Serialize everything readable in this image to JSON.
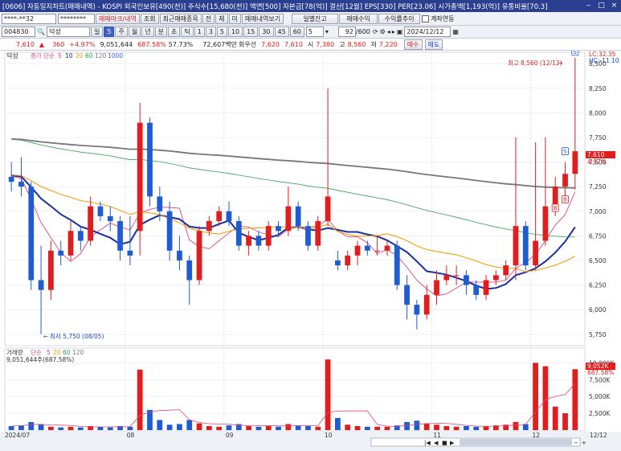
{
  "title": "[0606] 자동일지차트(매매내역) - KOSPI 외국인보유[490(천)] 주식수[15,680(천)] 액면[500] 자본금[78(억)] 결산[12월] EPS[330] PER[23.06] 시가총액[1,193(억)] 유통비율[70.3]",
  "toolbar1": {
    "account": "****-**32",
    "password": "********",
    "buttons": [
      "매매마크/내역",
      "조회",
      "최근매매종목",
      "전",
      "체",
      "미",
      "매매내역보기"
    ],
    "right_buttons": [
      "일별잔고",
      "매매수익",
      "수익률추이"
    ],
    "checkbox_label": "계좌연동"
  },
  "toolbar2": {
    "code": "004830",
    "name": "덕성",
    "periods": [
      "일",
      "5",
      "주",
      "월",
      "년",
      "분",
      "초",
      "틱"
    ],
    "intervals": [
      "1",
      "3",
      "5",
      "10",
      "15",
      "30",
      "45",
      "60"
    ],
    "interval_select": "5",
    "count": "92",
    "total": "600",
    "date": "2024/12/12"
  },
  "quote": {
    "price": "7,610",
    "change": "360",
    "change_pct": "+4.97%",
    "volume": "9,051,644",
    "volume_ratio": "687.58%",
    "turnover": "57.73%",
    "amount": "72,607백만",
    "prefname_label": "회우선",
    "pref_price": "7,620",
    "close_label": "7,610",
    "open_label": "시",
    "open": "7,380",
    "high_label": "고",
    "high": "8,560",
    "low_label": "저",
    "low": "7,220",
    "buy_label": "매수",
    "sell_label": "매도"
  },
  "chart": {
    "stock_name": "덕성",
    "ma_label": "종가 단순",
    "ma_periods": [
      "5",
      "10",
      "20",
      "60",
      "120",
      "1000"
    ],
    "ma_colors": [
      "#e0457b",
      "#1a2ea0",
      "#f0a010",
      "#30a050",
      "#777777",
      "#4060e0"
    ],
    "up_color": "#e11d1d",
    "down_color": "#1f5bd1",
    "high_annotation": "최고 8,560 (12/12)",
    "low_annotation": "최저 5,750 (08/05)",
    "lc_label": "LC:32.35",
    "hc_label": "HC:-11.10",
    "price_tag": "7,610",
    "price_tag_pct": "4.97%",
    "y_ticks": [
      "8,500",
      "8,250",
      "8,000",
      "7,750",
      "7,500",
      "7,250",
      "7,000",
      "6,750",
      "6,500",
      "6,250",
      "6,000",
      "5,750"
    ],
    "x_labels": [
      "2024/07",
      "08",
      "09",
      "10",
      "11",
      "12",
      "12/12"
    ],
    "markers": [
      "S",
      "S",
      "B",
      "B"
    ]
  },
  "volume": {
    "label": "거래량",
    "ma_label": "단순",
    "ma_periods": [
      "5",
      "20",
      "60",
      "120"
    ],
    "summary": "9,051,644주(687.58%)",
    "y_ticks": [
      "10,000K",
      "7,500K",
      "5,000K",
      "2,500K"
    ],
    "vol_tag": "9,052K",
    "vol_tag_pct": "687.58%"
  },
  "chart_data": {
    "type": "candlestick",
    "x": [
      "07/03",
      "07/05",
      "07/09",
      "07/11",
      "07/15",
      "07/17",
      "07/19",
      "07/23",
      "07/25",
      "07/29",
      "07/31",
      "08/02",
      "08/05",
      "08/07",
      "08/09",
      "08/13",
      "08/16",
      "08/20",
      "08/22",
      "08/26",
      "08/28",
      "08/30",
      "09/03",
      "09/05",
      "09/09",
      "09/11",
      "09/13",
      "09/19",
      "09/23",
      "09/25",
      "09/27",
      "10/02",
      "10/07",
      "10/10",
      "10/14",
      "10/16",
      "10/18",
      "10/22",
      "10/24",
      "10/28",
      "10/30",
      "11/01",
      "11/05",
      "11/07",
      "11/11",
      "11/13",
      "11/15",
      "11/19",
      "11/21",
      "11/25",
      "11/27",
      "11/29",
      "12/03",
      "12/05",
      "12/09",
      "12/10",
      "12/11",
      "12/12"
    ],
    "open": [
      7350,
      7300,
      7250,
      6300,
      6200,
      6600,
      6550,
      6800,
      6700,
      7050,
      6950,
      6900,
      6600,
      6800,
      7900,
      7150,
      7000,
      6600,
      6500,
      6300,
      6800,
      6900,
      7000,
      6900,
      6650,
      6750,
      6650,
      6850,
      6800,
      7050,
      6850,
      6650,
      6900,
      6500,
      6450,
      6550,
      6650,
      6600,
      6600,
      6650,
      6250,
      6050,
      5950,
      6150,
      6300,
      6350,
      6350,
      6250,
      6150,
      6300,
      6350,
      6450,
      6850,
      6450,
      6700,
      7050,
      7250,
      7380
    ],
    "close": [
      7300,
      7250,
      6300,
      6200,
      6600,
      6550,
      6800,
      6700,
      7050,
      6950,
      6900,
      6600,
      6550,
      7900,
      7150,
      7000,
      6600,
      6500,
      6300,
      6800,
      6900,
      7000,
      6900,
      6650,
      6750,
      6650,
      6850,
      6800,
      7050,
      6850,
      6650,
      6900,
      7150,
      6450,
      6550,
      6650,
      6600,
      6600,
      6650,
      6250,
      6050,
      5950,
      6150,
      6300,
      6350,
      6350,
      6250,
      6150,
      6300,
      6350,
      6450,
      6850,
      6450,
      6700,
      7050,
      7250,
      7380,
      7610
    ],
    "high": [
      7500,
      7550,
      7300,
      6650,
      6700,
      6700,
      6900,
      6850,
      7150,
      7100,
      7050,
      6950,
      6950,
      8100,
      7950,
      7250,
      7100,
      6750,
      6550,
      6850,
      6950,
      7050,
      7100,
      6950,
      6800,
      6800,
      6900,
      6900,
      7250,
      7100,
      6900,
      6950,
      8250,
      6600,
      6600,
      6700,
      6700,
      6750,
      6700,
      6700,
      6350,
      6100,
      6250,
      6400,
      6450,
      6450,
      6400,
      6300,
      6350,
      6400,
      6500,
      7750,
      6900,
      7700,
      7750,
      7350,
      7500,
      8560
    ],
    "low": [
      7200,
      7150,
      6200,
      5750,
      6100,
      6450,
      6500,
      6600,
      6650,
      6900,
      6800,
      6500,
      6450,
      6550,
      7050,
      6900,
      6500,
      6400,
      6050,
      6250,
      6750,
      6850,
      6850,
      6600,
      6550,
      6600,
      6600,
      6750,
      6750,
      6800,
      6600,
      6600,
      6850,
      6400,
      6400,
      6450,
      6550,
      6550,
      6550,
      6200,
      5900,
      5800,
      5900,
      6050,
      6250,
      6250,
      6150,
      6100,
      6100,
      6250,
      6300,
      6300,
      6400,
      6400,
      6650,
      6950,
      7150,
      7220
    ],
    "volume": [
      600,
      700,
      1200,
      900,
      500,
      400,
      500,
      400,
      600,
      500,
      400,
      600,
      500,
      9000,
      3000,
      1500,
      800,
      900,
      1500,
      1000,
      600,
      500,
      700,
      900,
      600,
      500,
      600,
      500,
      900,
      700,
      600,
      500,
      10500,
      1800,
      800,
      600,
      500,
      500,
      500,
      700,
      1200,
      1400,
      1000,
      800,
      600,
      500,
      600,
      500,
      600,
      700,
      800,
      1200,
      900,
      10000,
      9500,
      3500,
      2500,
      9052
    ],
    "ylim": [
      5650,
      8600
    ],
    "volume_ylim": [
      0,
      11000
    ]
  }
}
